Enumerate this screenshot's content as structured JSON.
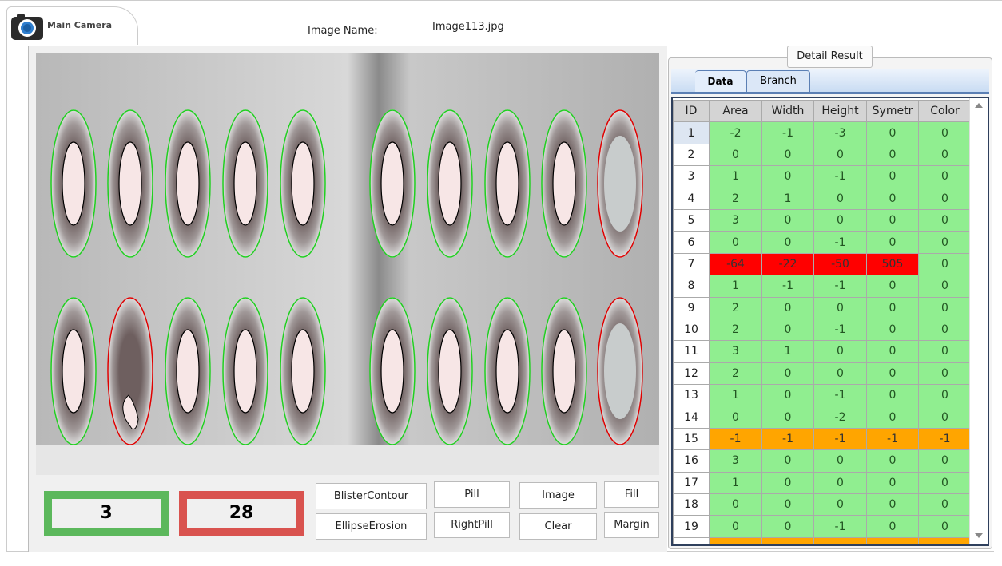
{
  "tab": {
    "label": "Main Camera"
  },
  "image_name": {
    "label": "Image Name:",
    "value": "Image113.jpg"
  },
  "counters": {
    "good": "3",
    "bad": "28",
    "good_color": "#5cb85c",
    "bad_color": "#d9534f"
  },
  "buttons": [
    "BlisterContour",
    "EllipseErosion",
    "Pill",
    "RightPill",
    "Image",
    "Clear",
    "Fill",
    "Margin"
  ],
  "detail": {
    "title": "Detail Result",
    "tabs": [
      "Data",
      "Branch"
    ],
    "columns": [
      "ID",
      "Area",
      "Width",
      "Height",
      "Symetr",
      "Color"
    ],
    "status_colors": {
      "ok": "#90ee90",
      "fail": "#ff0000",
      "warn": "#ffa500"
    },
    "rows": [
      {
        "id": "1",
        "v": [
          "-2",
          "-1",
          "-3",
          "0",
          "0"
        ],
        "s": [
          "ok",
          "ok",
          "ok",
          "ok",
          "ok"
        ]
      },
      {
        "id": "2",
        "v": [
          "0",
          "0",
          "0",
          "0",
          "0"
        ],
        "s": [
          "ok",
          "ok",
          "ok",
          "ok",
          "ok"
        ]
      },
      {
        "id": "3",
        "v": [
          "1",
          "0",
          "-1",
          "0",
          "0"
        ],
        "s": [
          "ok",
          "ok",
          "ok",
          "ok",
          "ok"
        ]
      },
      {
        "id": "4",
        "v": [
          "2",
          "1",
          "0",
          "0",
          "0"
        ],
        "s": [
          "ok",
          "ok",
          "ok",
          "ok",
          "ok"
        ]
      },
      {
        "id": "5",
        "v": [
          "3",
          "0",
          "0",
          "0",
          "0"
        ],
        "s": [
          "ok",
          "ok",
          "ok",
          "ok",
          "ok"
        ]
      },
      {
        "id": "6",
        "v": [
          "0",
          "0",
          "-1",
          "0",
          "0"
        ],
        "s": [
          "ok",
          "ok",
          "ok",
          "ok",
          "ok"
        ]
      },
      {
        "id": "7",
        "v": [
          "-64",
          "-22",
          "-50",
          "505",
          "0"
        ],
        "s": [
          "fail",
          "fail",
          "fail",
          "fail",
          "ok"
        ]
      },
      {
        "id": "8",
        "v": [
          "1",
          "-1",
          "-1",
          "0",
          "0"
        ],
        "s": [
          "ok",
          "ok",
          "ok",
          "ok",
          "ok"
        ]
      },
      {
        "id": "9",
        "v": [
          "2",
          "0",
          "0",
          "0",
          "0"
        ],
        "s": [
          "ok",
          "ok",
          "ok",
          "ok",
          "ok"
        ]
      },
      {
        "id": "10",
        "v": [
          "2",
          "0",
          "-1",
          "0",
          "0"
        ],
        "s": [
          "ok",
          "ok",
          "ok",
          "ok",
          "ok"
        ]
      },
      {
        "id": "11",
        "v": [
          "3",
          "1",
          "0",
          "0",
          "0"
        ],
        "s": [
          "ok",
          "ok",
          "ok",
          "ok",
          "ok"
        ]
      },
      {
        "id": "12",
        "v": [
          "2",
          "0",
          "0",
          "0",
          "0"
        ],
        "s": [
          "ok",
          "ok",
          "ok",
          "ok",
          "ok"
        ]
      },
      {
        "id": "13",
        "v": [
          "1",
          "0",
          "-1",
          "0",
          "0"
        ],
        "s": [
          "ok",
          "ok",
          "ok",
          "ok",
          "ok"
        ]
      },
      {
        "id": "14",
        "v": [
          "0",
          "0",
          "-2",
          "0",
          "0"
        ],
        "s": [
          "ok",
          "ok",
          "ok",
          "ok",
          "ok"
        ]
      },
      {
        "id": "15",
        "v": [
          "-1",
          "-1",
          "-1",
          "-1",
          "-1"
        ],
        "s": [
          "warn",
          "warn",
          "warn",
          "warn",
          "warn"
        ]
      },
      {
        "id": "16",
        "v": [
          "3",
          "0",
          "0",
          "0",
          "0"
        ],
        "s": [
          "ok",
          "ok",
          "ok",
          "ok",
          "ok"
        ]
      },
      {
        "id": "17",
        "v": [
          "1",
          "0",
          "0",
          "0",
          "0"
        ],
        "s": [
          "ok",
          "ok",
          "ok",
          "ok",
          "ok"
        ]
      },
      {
        "id": "18",
        "v": [
          "0",
          "0",
          "0",
          "0",
          "0"
        ],
        "s": [
          "ok",
          "ok",
          "ok",
          "ok",
          "ok"
        ]
      },
      {
        "id": "19",
        "v": [
          "0",
          "0",
          "-1",
          "0",
          "0"
        ],
        "s": [
          "ok",
          "ok",
          "ok",
          "ok",
          "ok"
        ]
      },
      {
        "id": "",
        "v": [
          "",
          "",
          "",
          "",
          ""
        ],
        "s": [
          "warn",
          "warn",
          "warn",
          "warn",
          "warn"
        ]
      }
    ]
  }
}
